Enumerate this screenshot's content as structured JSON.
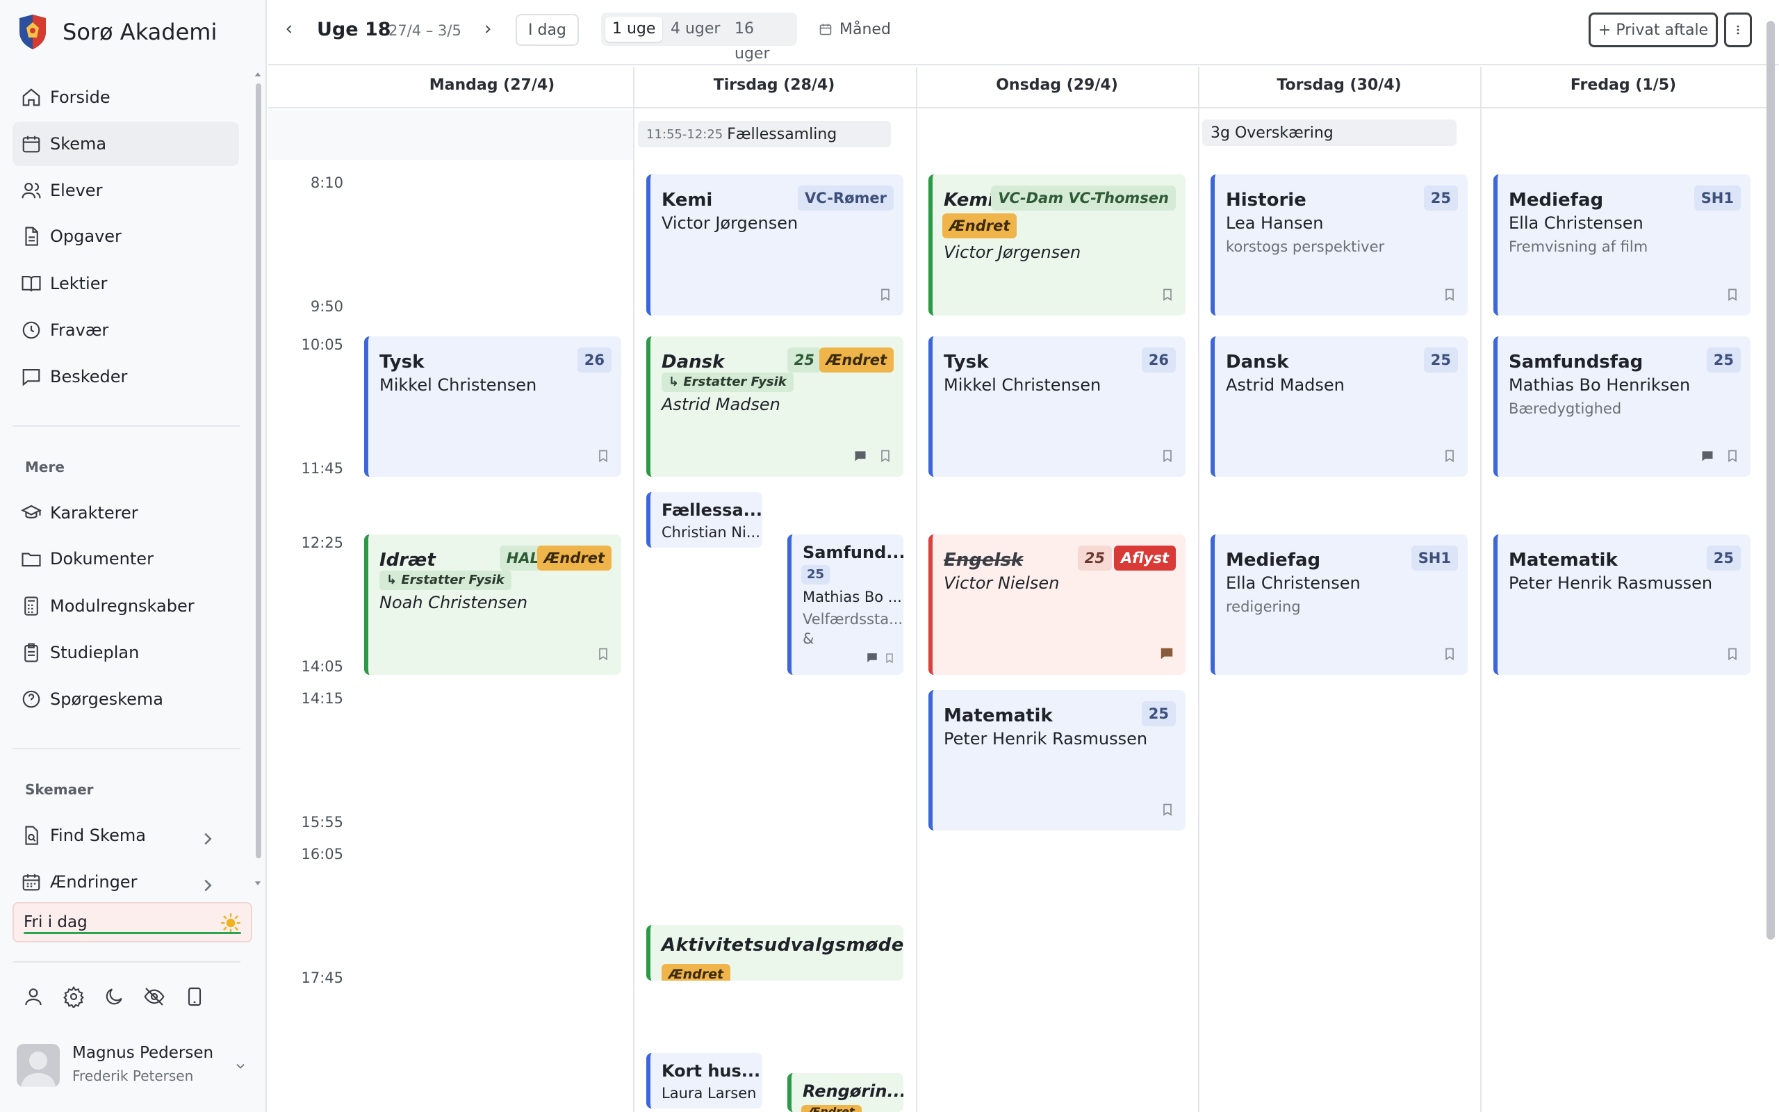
{
  "sidebar": {
    "school_name": "Sorø Akademi",
    "main_nav": [
      "Forside",
      "Skema",
      "Elever",
      "Opgaver",
      "Lektier",
      "Fravær",
      "Beskeder"
    ],
    "more_label": "Mere",
    "more_nav": [
      "Karakterer",
      "Dokumenter",
      "Modulregnskaber",
      "Studieplan",
      "Spørgeskema"
    ],
    "schedules_label": "Skemaer",
    "schedule_nav": [
      "Find Skema",
      "Ændringer"
    ],
    "free_today": "Fri i dag",
    "user_name": "Magnus Pedersen",
    "user_sub": "Frederik Petersen"
  },
  "toolbar": {
    "week_label": "Uge 18",
    "week_range": "27/4 – 3/5",
    "today_label": "I dag",
    "range_options": [
      "1 uge",
      "4 uger",
      "16 uger"
    ],
    "month_label": "Måned",
    "private_label": "+ Privat aftale"
  },
  "days": [
    "Mandag (27/4)",
    "Tirsdag (28/4)",
    "Onsdag (29/4)",
    "Torsdag (30/4)",
    "Fredag (1/5)"
  ],
  "times": [
    "8:10",
    "9:50",
    "10:05",
    "11:45",
    "12:25",
    "14:05",
    "14:15",
    "15:55",
    "16:05",
    "17:45"
  ],
  "allday": {
    "tue_time": "11:55-12:25",
    "tue_name": "Fællessamling",
    "thu_name": "3g Overskæring"
  },
  "labels": {
    "changed": "Ændret",
    "cancelled": "Aflyst",
    "replaces": "↳ Erstatter Fysik"
  },
  "events": {
    "mon_tysk": {
      "subject": "Tysk",
      "room": "26",
      "teacher": "Mikkel Christensen"
    },
    "mon_idraet": {
      "subject": "Idræt",
      "room": "HAL",
      "teacher": "Noah Christensen"
    },
    "tue_kemi": {
      "subject": "Kemi",
      "room": "VC-Rømer",
      "teacher": "Victor Jørgensen"
    },
    "tue_dansk": {
      "subject": "Dansk",
      "room": "25",
      "teacher": "Astrid Madsen"
    },
    "tue_faelles": {
      "subject": "Fællessa...",
      "teacher": "Christian Ni..."
    },
    "tue_samfund": {
      "subject": "Samfund...",
      "room": "25",
      "teacher": "Mathias Bo ...",
      "note": "Velfærdssta...",
      "note2": "&"
    },
    "tue_aktivitet": {
      "subject": "Aktivitetsudvalgsmøde"
    },
    "tue_korthus": {
      "subject": "Kort hus...",
      "teacher": "Laura Larsen"
    },
    "tue_rengoring": {
      "subject": "Rengørin...",
      "tag": "Ændret"
    },
    "wed_kemi": {
      "subject": "Kemi",
      "room": "VC-Dam VC-Thomsen",
      "teacher": "Victor Jørgensen"
    },
    "wed_tysk": {
      "subject": "Tysk",
      "room": "26",
      "teacher": "Mikkel Christensen"
    },
    "wed_engelsk": {
      "subject": "Engelsk",
      "room": "25",
      "teacher": "Victor Nielsen"
    },
    "wed_mat": {
      "subject": "Matematik",
      "room": "25",
      "teacher": "Peter Henrik Rasmussen"
    },
    "thu_hist": {
      "subject": "Historie",
      "room": "25",
      "teacher": "Lea Hansen",
      "note": "korstogs perspektiver"
    },
    "thu_dansk": {
      "subject": "Dansk",
      "room": "25",
      "teacher": "Astrid Madsen"
    },
    "thu_medie": {
      "subject": "Mediefag",
      "room": "SH1",
      "teacher": "Ella Christensen",
      "note": "redigering"
    },
    "fri_medie": {
      "subject": "Mediefag",
      "room": "SH1",
      "teacher": "Ella Christensen",
      "note": "Fremvisning af film"
    },
    "fri_samf": {
      "subject": "Samfundsfag",
      "room": "25",
      "teacher": "Mathias Bo Henriksen",
      "note": "Bæredygtighed"
    },
    "fri_mat": {
      "subject": "Matematik",
      "room": "25",
      "teacher": "Peter Henrik Rasmussen"
    }
  }
}
